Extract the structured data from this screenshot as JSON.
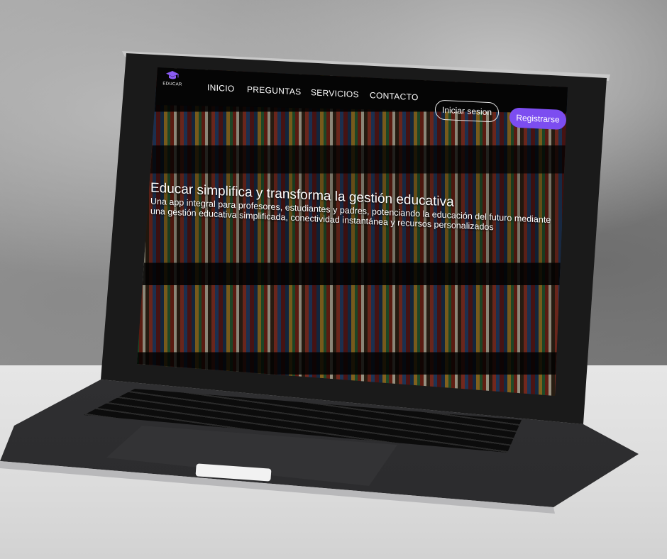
{
  "app": {
    "logo_text": "EDUCAR",
    "accent_color": "#7c4df0"
  },
  "nav": {
    "items": [
      {
        "label": "INICIO"
      },
      {
        "label": "PREGUNTAS"
      },
      {
        "label": "SERVICIOS"
      },
      {
        "label": "CONTACTO"
      }
    ],
    "login_label": "Iniciar sesion",
    "register_label": "Registrarse"
  },
  "hero": {
    "title": "Educar simplifica y transforma la gestión educativa",
    "subtitle": "Una app integral para profesores, estudiantes y padres, potenciando la educación del futuro mediante una gestión educativa simplificada, conectividad instantánea y recursos personalizados",
    "background": "bookshelf-photo"
  },
  "icons": {
    "logo": "graduation-cap-icon"
  }
}
